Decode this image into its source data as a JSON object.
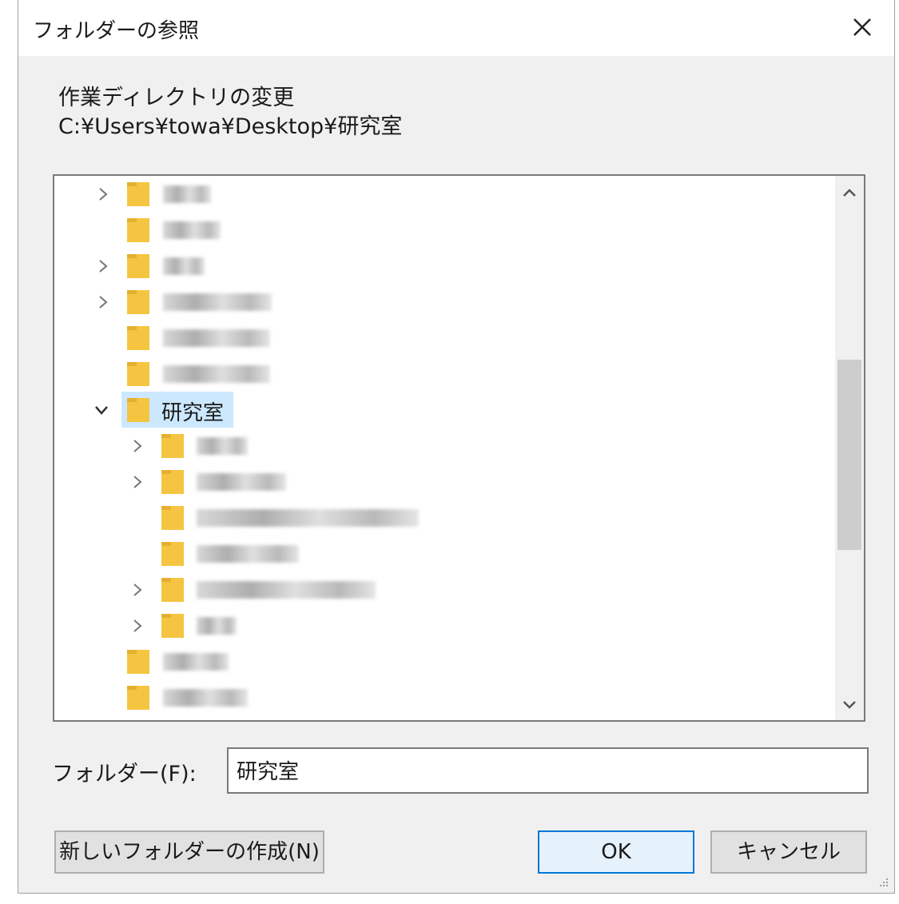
{
  "dialog": {
    "title": "フォルダーの参照",
    "description_line1": "作業ディレクトリの変更",
    "description_line2": "C:¥Users¥towa¥Desktop¥研究室"
  },
  "tree": {
    "selected_label": "研究室"
  },
  "folder_field": {
    "label": "フォルダー(F):",
    "value": "研究室"
  },
  "buttons": {
    "new_folder": "新しいフォルダーの作成(N)",
    "ok": "OK",
    "cancel": "キャンセル"
  },
  "icons": {
    "close": "close-icon",
    "folder": "folder-icon",
    "chevron_right": "chevron-right-icon",
    "chevron_down": "chevron-down-icon"
  },
  "colors": {
    "folder": "#f5c542",
    "selection": "#cce8ff",
    "ok_border": "#0078d7"
  }
}
